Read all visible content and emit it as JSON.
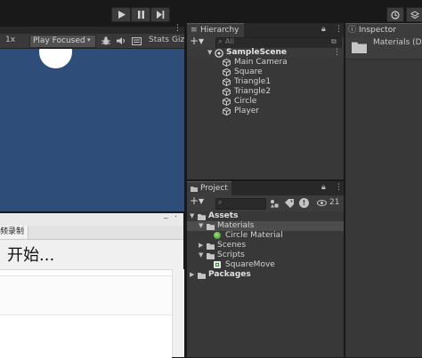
{
  "toolbar": {
    "play": "play-icon",
    "pause": "pause-icon",
    "step": "step-icon",
    "history": "history-icon",
    "layers": "layers-icon"
  },
  "game": {
    "scale": "1x",
    "play_mode": "Play Focused",
    "stats": "Stats",
    "gizmos": "Giz",
    "background_color": "#2e4e79",
    "circle_color": "#ffffff"
  },
  "recorder": {
    "tab": "频录制",
    "status": "开始...",
    "minimize": "_",
    "close": "."
  },
  "hierarchy": {
    "tab": "Hierarchy",
    "add": "+▾",
    "search_placeholder": "All",
    "scene": "SampleScene",
    "objects": [
      "Main Camera",
      "Square",
      "Triangle1",
      "Triangle2",
      "Circle",
      "Player"
    ]
  },
  "project": {
    "tab": "Project",
    "add": "+▾",
    "hidden_count": "21",
    "tree": [
      {
        "label": "Assets",
        "level": 0,
        "expanded": true,
        "kind": "folder",
        "bold": true
      },
      {
        "label": "Materials",
        "level": 1,
        "expanded": true,
        "kind": "folder",
        "selected": true
      },
      {
        "label": "Circle Material",
        "level": 2,
        "kind": "material"
      },
      {
        "label": "Scenes",
        "level": 1,
        "expanded": false,
        "kind": "folder"
      },
      {
        "label": "Scripts",
        "level": 1,
        "expanded": true,
        "kind": "folder"
      },
      {
        "label": "SquareMove",
        "level": 2,
        "kind": "script"
      },
      {
        "label": "Packages",
        "level": 0,
        "expanded": false,
        "kind": "folder",
        "bold": true
      }
    ]
  },
  "inspector": {
    "tab": "Inspector",
    "title": "Materials (D"
  }
}
